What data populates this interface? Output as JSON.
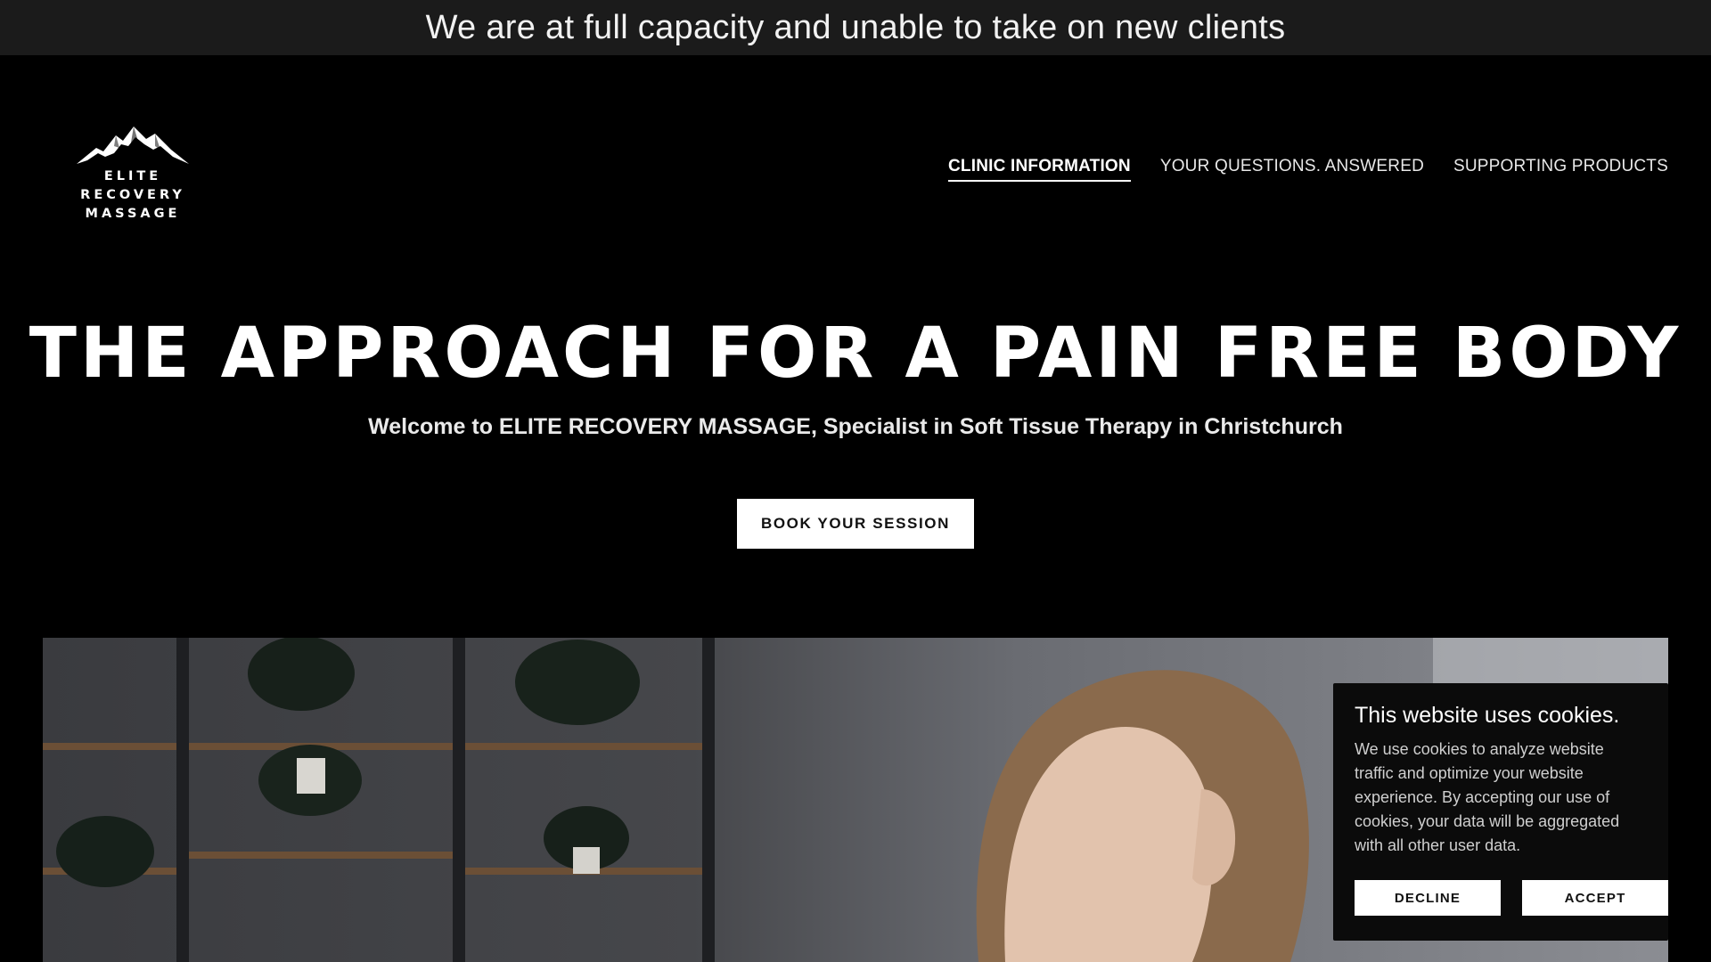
{
  "announcement": {
    "text": "We are at full capacity and unable to take on new clients"
  },
  "logo": {
    "line1": "ELITE RECOVERY",
    "line2": "MASSAGE",
    "icon": "mountain-icon"
  },
  "nav": {
    "items": [
      {
        "label": "CLINIC INFORMATION",
        "active": true
      },
      {
        "label": "YOUR QUESTIONS. ANSWERED",
        "active": false
      },
      {
        "label": "SUPPORTING PRODUCTS",
        "active": false
      }
    ]
  },
  "hero": {
    "title": "THE APPROACH FOR A PAIN FREE BODY",
    "subtitle": "Welcome to ELITE RECOVERY MASSAGE, Specialist in Soft Tissue Therapy in Christchurch",
    "cta_label": "BOOK YOUR SESSION"
  },
  "cookie_banner": {
    "title": "This website uses cookies.",
    "body": "We use cookies to analyze website traffic and optimize your website experience. By accepting our use of cookies, your data will be aggregated with all other user data.",
    "decline_label": "DECLINE",
    "accept_label": "ACCEPT"
  },
  "colors": {
    "background": "#000000",
    "announcement_bg": "#1b1b1b",
    "button_bg": "#ffffff",
    "button_text": "#111111"
  }
}
